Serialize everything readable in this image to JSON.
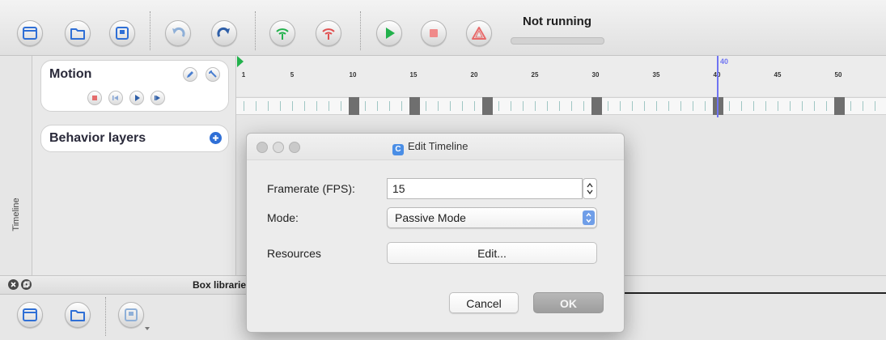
{
  "toolbar": {
    "status": "Not running",
    "status_progress": 0,
    "buttons": [
      "new-file",
      "open-file",
      "save-file",
      "undo",
      "redo",
      "connect",
      "disconnect",
      "play",
      "stop",
      "warning"
    ]
  },
  "side_tab": {
    "label": "Timeline"
  },
  "motion_panel": {
    "title": "Motion"
  },
  "behavior_panel": {
    "title": "Behavior layers"
  },
  "timeline": {
    "ticks": [
      "1",
      "5",
      "10",
      "15",
      "20",
      "25",
      "30",
      "35",
      "40",
      "45",
      "50"
    ],
    "cursor_frame": "40",
    "keyframes": [
      10,
      15,
      21,
      30,
      40,
      50
    ]
  },
  "box_library": {
    "title": "Box librarie"
  },
  "dialog": {
    "title": "Edit Timeline",
    "app_icon_letter": "C",
    "framerate_label": "Framerate (FPS):",
    "framerate_value": "15",
    "mode_label": "Mode:",
    "mode_value": "Passive Mode",
    "resources_label": "Resources",
    "edit_button": "Edit...",
    "cancel_button": "Cancel",
    "ok_button": "OK"
  },
  "colors": {
    "accent": "#2f6fd6",
    "green": "#22b14c",
    "red": "#e05050",
    "cursor": "#6f74f2"
  }
}
